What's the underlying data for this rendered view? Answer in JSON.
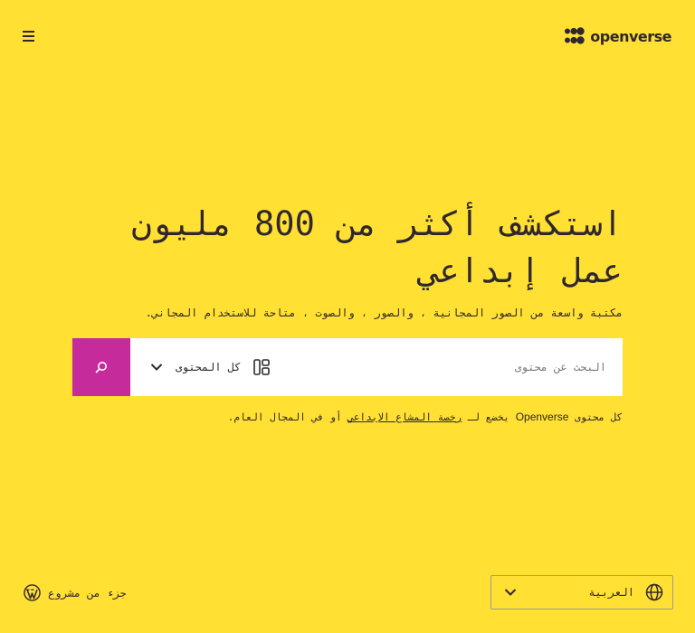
{
  "header": {
    "menu_icon": "hamburger-icon",
    "logo_text": "openverse"
  },
  "hero": {
    "headline": "استكشف أكثر من 800 مليون عمل إبداعي",
    "subtitle": "مكتبة واسعة من الصور المجانية ، والصور ، والصوت ، متاحة للاستخدام المجاني."
  },
  "search": {
    "placeholder": "البحث عن محتوى",
    "value": "",
    "content_type": "كل المحتوى",
    "button_icon": "search-icon"
  },
  "license_note": {
    "prefix": "كل محتوى ",
    "brand": "Openverse",
    "middle": " يخضع لـ ",
    "link": "رخصة المشاع الإبداعي",
    "suffix": " أو في المجال العام."
  },
  "footer": {
    "wordpress_text": "جزء من مشروع",
    "language": "العربية"
  },
  "colors": {
    "background": "#ffe033",
    "accent": "#c52b9b",
    "text": "#30272e"
  }
}
